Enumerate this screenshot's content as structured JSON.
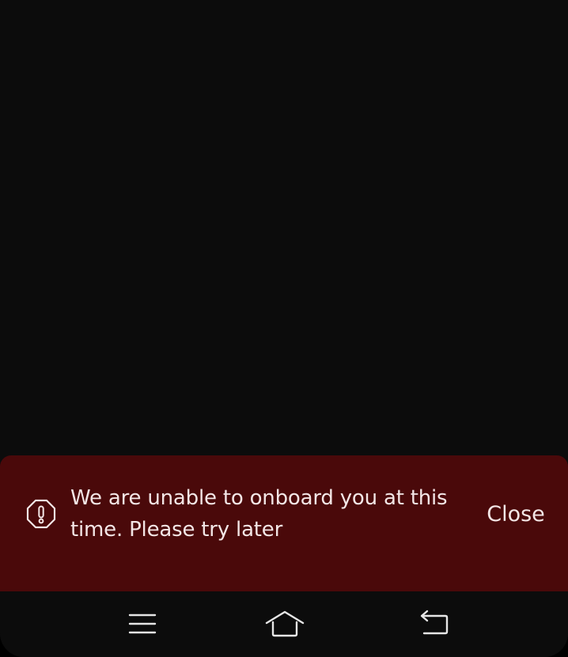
{
  "snackbar": {
    "message": "We are unable to onboard you at this time. Please try later",
    "close_label": "Close",
    "icon": "alert-octagon-icon",
    "background_color": "#4a090a",
    "text_color": "#f3e6e6"
  },
  "screen": {
    "background_color": "#0c0c0c"
  },
  "navbar": {
    "icons": [
      "recent-apps-icon",
      "home-icon",
      "back-icon"
    ]
  }
}
